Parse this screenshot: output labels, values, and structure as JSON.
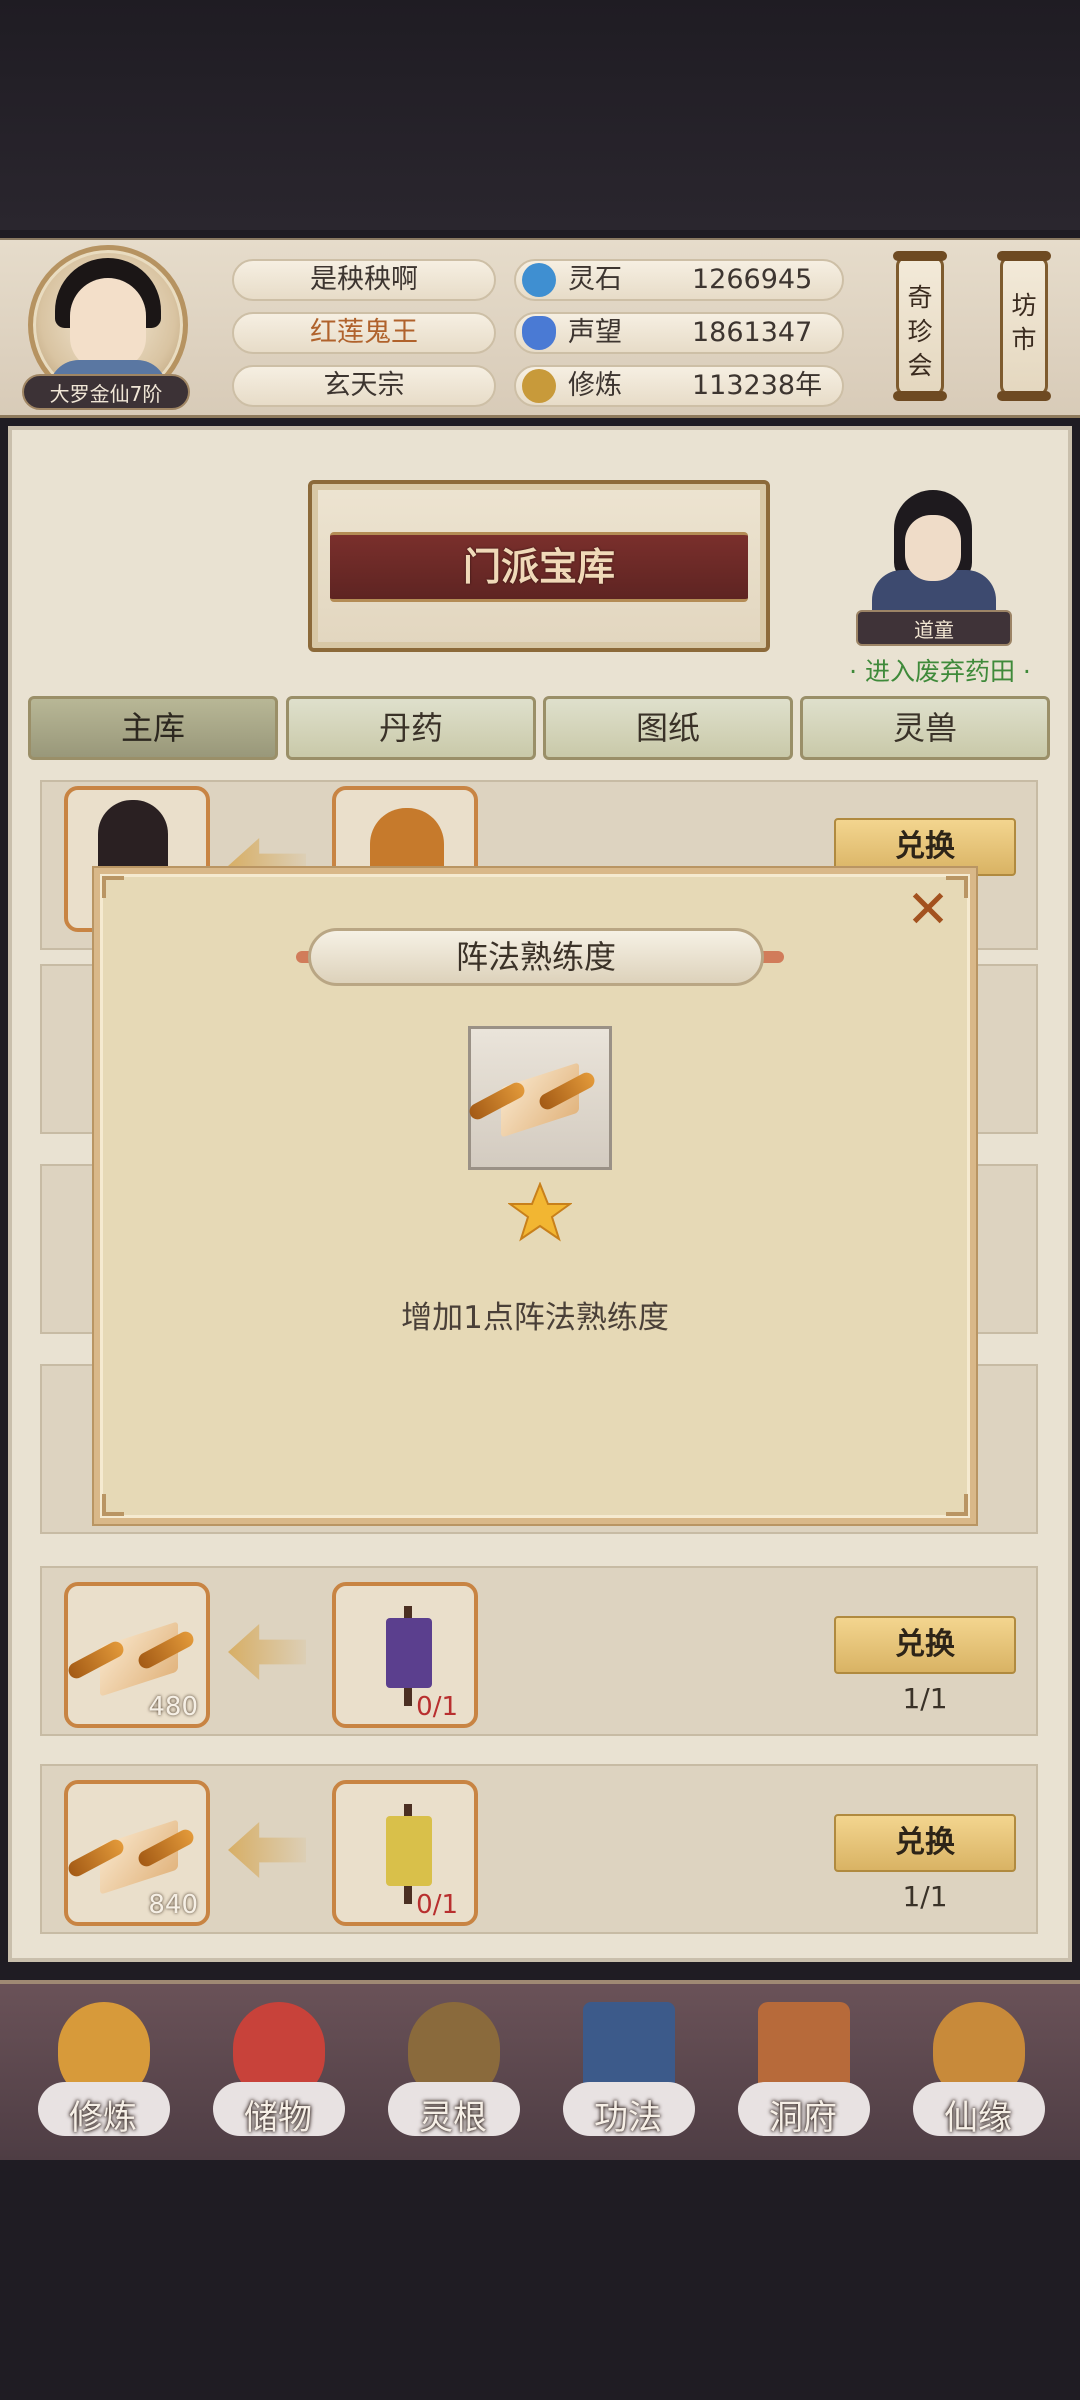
{
  "player": {
    "name": "是秧秧啊",
    "title": "红莲鬼王",
    "sect": "玄天宗",
    "rank": "大罗金仙7阶"
  },
  "resources": [
    {
      "label": "灵石",
      "value": "1266945",
      "icon": "spirit-stone-icon",
      "color": "#3f8fd1"
    },
    {
      "label": "声望",
      "value": "1861347",
      "icon": "reputation-crystal-icon",
      "color": "#4a7ad4"
    },
    {
      "label": "修炼",
      "value": "113238年",
      "icon": "meditation-icon",
      "color": "#c89a3a"
    }
  ],
  "side_buttons": [
    {
      "label": "奇\n珍\n会"
    },
    {
      "label": "坊\n市"
    }
  ],
  "vault": {
    "title": "门派宝库",
    "npc_tag": "道童",
    "npc_link": "· 进入废弃药田 ·"
  },
  "tabs": [
    "主库",
    "丹药",
    "图纸",
    "灵兽"
  ],
  "active_tab": 0,
  "rows": [
    {
      "exchange_label": "兑换",
      "limit": "",
      "reward_icon": "character-portrait-icon",
      "cost_icon": "gourd-icon",
      "reward_count": "",
      "cost_need": ""
    },
    {
      "exchange_label": "",
      "limit": "",
      "reward_count": "",
      "cost_need": ""
    },
    {
      "exchange_label": "",
      "limit": "",
      "reward_count": "",
      "cost_need": ""
    },
    {
      "exchange_label": "",
      "limit": "",
      "reward_count": "",
      "cost_need": ""
    },
    {
      "exchange_label": "兑换",
      "limit": "1/1",
      "reward_count": "480",
      "cost_need": "0/1",
      "reward_icon": "formation-scroll-icon",
      "cost_icon": "purple-banner-icon"
    },
    {
      "exchange_label": "兑换",
      "limit": "1/1",
      "reward_count": "840",
      "cost_need": "0/1",
      "reward_icon": "formation-scroll-icon",
      "cost_icon": "yellow-banner-icon"
    }
  ],
  "dialog": {
    "title": "阵法熟练度",
    "description": "增加1点阵法熟练度",
    "close_icon": "close-icon",
    "item_icon": "formation-scroll-icon",
    "stars": 1
  },
  "nav": [
    {
      "label": "修炼",
      "icon": "cultivation-icon",
      "color": "#d79a3a"
    },
    {
      "label": "储物",
      "icon": "storage-bag-icon",
      "color": "#c8423a"
    },
    {
      "label": "灵根",
      "icon": "spirit-root-icon",
      "color": "#8a6a3c"
    },
    {
      "label": "功法",
      "icon": "technique-book-icon",
      "color": "#3c5a8a"
    },
    {
      "label": "洞府",
      "icon": "cave-residence-icon",
      "color": "#b76a3a"
    },
    {
      "label": "仙缘",
      "icon": "immortal-fate-icon",
      "color": "#c88a3a"
    }
  ]
}
